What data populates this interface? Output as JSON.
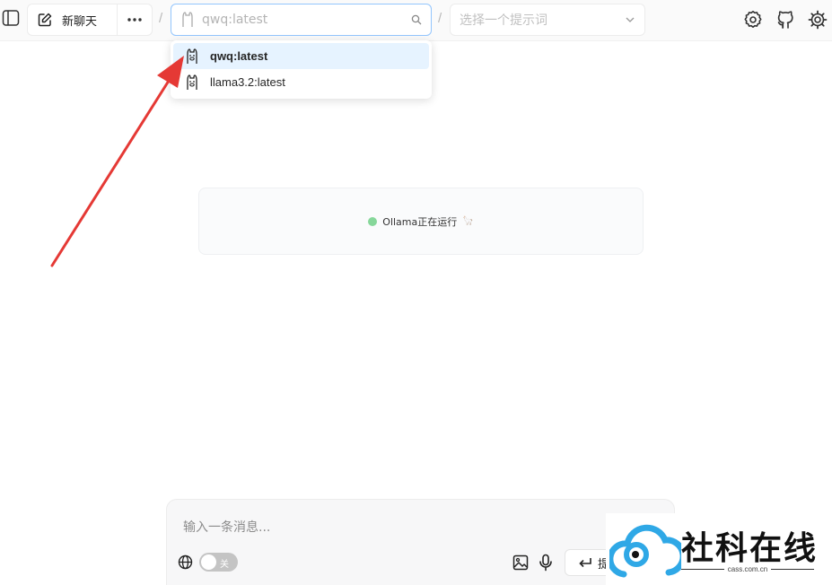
{
  "header": {
    "new_chat_label": "新聊天",
    "separator": "/",
    "model_select": {
      "value": "",
      "placeholder": "qwq:latest"
    },
    "prompt_select": {
      "placeholder": "选择一个提示词"
    }
  },
  "model_dropdown": {
    "options": [
      {
        "label": "qwq:latest",
        "active": true
      },
      {
        "label": "llama3.2:latest",
        "active": false
      }
    ]
  },
  "status": {
    "text": "Ollama正在运行",
    "emoji": "🦙"
  },
  "composer": {
    "placeholder": "输入一条消息...",
    "web_toggle_label": "关",
    "send_label": "提"
  },
  "watermark": {
    "brand": "社科在线",
    "domain": "cass.com.cn"
  },
  "colors": {
    "accent_border": "#93c5fd",
    "active_option_bg": "#e6f3ff",
    "status_dot": "#86d79a",
    "arrow": "#e53935",
    "watermark_blue": "#2fa8e6"
  }
}
